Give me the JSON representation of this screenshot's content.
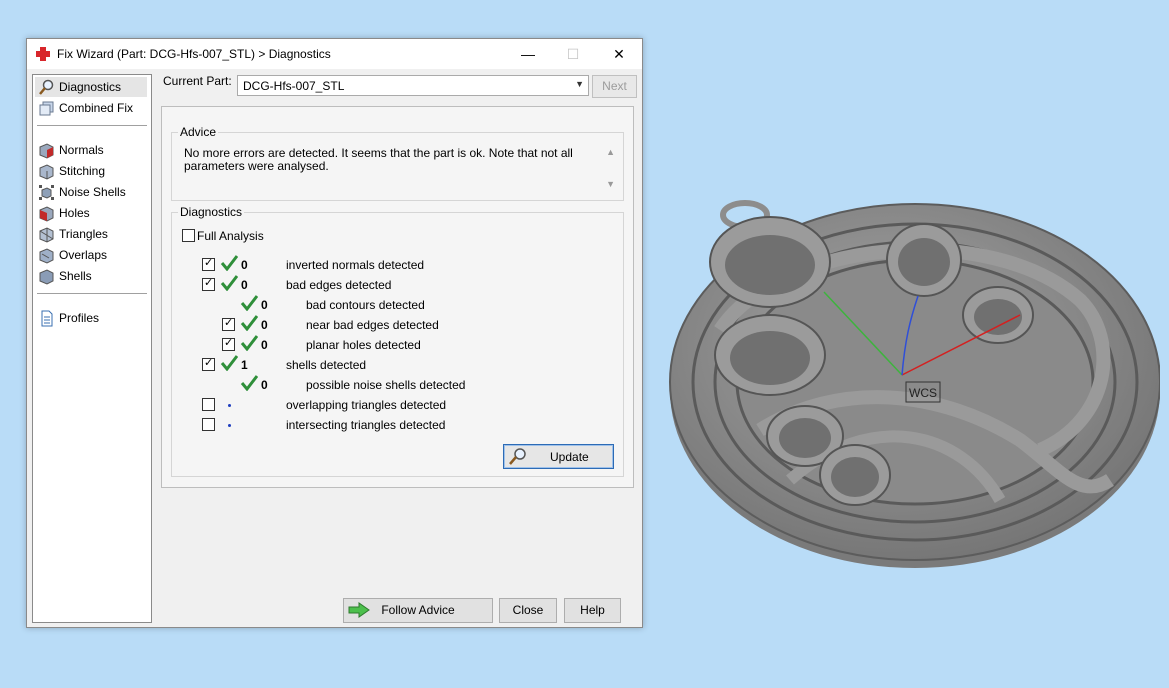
{
  "window": {
    "title": "Fix Wizard (Part: DCG-Hfs-007_STL) > Diagnostics",
    "minimize": "—",
    "maximize": "☐",
    "close": "✕"
  },
  "nav": {
    "items": [
      {
        "label": "Diagnostics",
        "icon": "magnifier-icon",
        "active": true
      },
      {
        "label": "Combined Fix",
        "icon": "combined-fix-icon"
      },
      {
        "label": "Normals",
        "icon": "normals-cube-icon"
      },
      {
        "label": "Stitching",
        "icon": "stitching-cube-icon"
      },
      {
        "label": "Noise Shells",
        "icon": "noise-shells-cube-icon"
      },
      {
        "label": "Holes",
        "icon": "holes-cube-icon"
      },
      {
        "label": "Triangles",
        "icon": "triangles-cube-icon"
      },
      {
        "label": "Overlaps",
        "icon": "overlaps-cube-icon"
      },
      {
        "label": "Shells",
        "icon": "shells-cube-icon"
      },
      {
        "label": "Profiles",
        "icon": "profiles-document-icon"
      }
    ]
  },
  "part": {
    "label": "Current Part:",
    "value": "DCG-Hfs-007_STL",
    "next_label": "Next"
  },
  "advice": {
    "title": "Advice",
    "text": "No more errors are detected. It seems that the part is ok. Note that not all parameters were analysed."
  },
  "diagnostics": {
    "title": "Diagnostics",
    "full_analysis": "Full Analysis",
    "rows": [
      {
        "checked": true,
        "status": "ok",
        "count": "0",
        "label": "inverted normals detected"
      },
      {
        "checked": true,
        "status": "ok",
        "count": "0",
        "label": "bad edges detected"
      },
      {
        "checked": null,
        "status": "ok",
        "count": "0",
        "label": "bad contours detected"
      },
      {
        "checked": true,
        "status": "ok",
        "count": "0",
        "label": "near bad edges detected"
      },
      {
        "checked": true,
        "status": "ok",
        "count": "0",
        "label": "planar holes detected"
      },
      {
        "checked": true,
        "status": "ok",
        "count": "1",
        "label": "shells detected"
      },
      {
        "checked": null,
        "status": "ok",
        "count": "0",
        "label": "possible noise shells detected"
      },
      {
        "checked": false,
        "status": "pending",
        "count": "",
        "label": "overlapping triangles detected"
      },
      {
        "checked": false,
        "status": "pending",
        "count": "",
        "label": "intersecting triangles detected"
      }
    ],
    "update_label": "Update"
  },
  "footer": {
    "follow_advice": "Follow Advice",
    "close": "Close",
    "help": "Help"
  },
  "viewport": {
    "wcs_label": "WCS"
  },
  "colors": {
    "background": "#b9dcf7",
    "accent": "#2d6bb5",
    "ok_green": "#2f8f3a",
    "model_gray": "#8c8c8c"
  }
}
